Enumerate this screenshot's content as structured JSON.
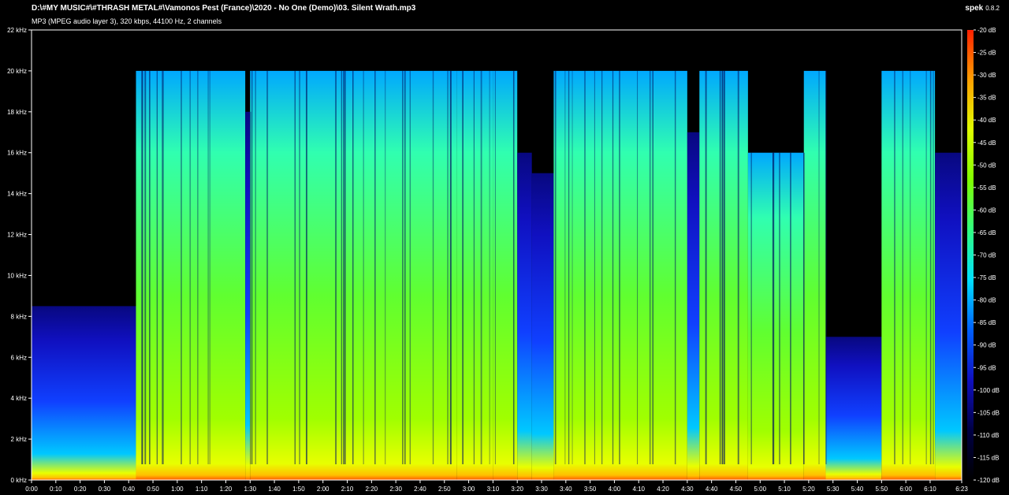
{
  "header": {
    "file_path": "D:\\#MY MUSIC#\\#THRASH METAL#\\Vamonos Pest (France)\\2020 - No One (Demo)\\03. Silent Wrath.mp3",
    "format_info": "MP3 (MPEG audio layer 3), 320 kbps, 44100 Hz, 2 channels",
    "app_name": "spek",
    "app_version": "0.8.2"
  },
  "chart_data": {
    "type": "heatmap",
    "title": "",
    "xlabel": "",
    "ylabel": "",
    "duration_seconds": 383,
    "ylim_khz": [
      0,
      22
    ],
    "x_ticks": [
      "0:00",
      "0:10",
      "0:20",
      "0:30",
      "0:40",
      "0:50",
      "1:00",
      "1:10",
      "1:20",
      "1:30",
      "1:40",
      "1:50",
      "2:00",
      "2:10",
      "2:20",
      "2:30",
      "2:40",
      "2:50",
      "3:00",
      "3:10",
      "3:20",
      "3:30",
      "3:40",
      "3:50",
      "4:00",
      "4:10",
      "4:20",
      "4:30",
      "4:40",
      "4:50",
      "5:00",
      "5:10",
      "5:20",
      "5:30",
      "5:40",
      "5:50",
      "6:00",
      "6:10",
      "6:23"
    ],
    "x_tick_seconds": [
      0,
      10,
      20,
      30,
      40,
      50,
      60,
      70,
      80,
      90,
      100,
      110,
      120,
      130,
      140,
      150,
      160,
      170,
      180,
      190,
      200,
      210,
      220,
      230,
      240,
      250,
      260,
      270,
      280,
      290,
      300,
      310,
      320,
      330,
      340,
      350,
      360,
      370,
      383
    ],
    "y_ticks": [
      "0 kHz",
      "2 kHz",
      "4 kHz",
      "6 kHz",
      "8 kHz",
      "10 kHz",
      "12 kHz",
      "14 kHz",
      "16 kHz",
      "18 kHz",
      "20 kHz",
      "22 kHz"
    ],
    "y_tick_khz": [
      0,
      2,
      4,
      6,
      8,
      10,
      12,
      14,
      16,
      18,
      20,
      22
    ],
    "db_range": [
      -120,
      -20
    ],
    "db_ticks": [
      "-20 dB",
      "-25 dB",
      "-30 dB",
      "-35 dB",
      "-40 dB",
      "-45 dB",
      "-50 dB",
      "-55 dB",
      "-60 dB",
      "-65 dB",
      "-70 dB",
      "-75 dB",
      "-80 dB",
      "-85 dB",
      "-90 dB",
      "-95 dB",
      "-100 dB",
      "-105 dB",
      "-110 dB",
      "-115 dB",
      "-120 dB"
    ],
    "db_tick_values": [
      -20,
      -25,
      -30,
      -35,
      -40,
      -45,
      -50,
      -55,
      -60,
      -65,
      -70,
      -75,
      -80,
      -85,
      -90,
      -95,
      -100,
      -105,
      -110,
      -115,
      -120
    ],
    "colormap": [
      "#000000",
      "#000044",
      "#1010c0",
      "#0060ff",
      "#00e0ff",
      "#30ff80",
      "#80ff00",
      "#e0ff00",
      "#ffa000",
      "#ff2000"
    ],
    "segments": [
      {
        "start": 0,
        "end": 43,
        "cutoff_khz": 8.5,
        "intensity": 0.35
      },
      {
        "start": 43,
        "end": 88,
        "cutoff_khz": 20,
        "intensity": 0.8
      },
      {
        "start": 88,
        "end": 90,
        "cutoff_khz": 18,
        "intensity": 0.6
      },
      {
        "start": 90,
        "end": 175,
        "cutoff_khz": 20,
        "intensity": 0.82
      },
      {
        "start": 175,
        "end": 190,
        "cutoff_khz": 20,
        "intensity": 0.7
      },
      {
        "start": 190,
        "end": 200,
        "cutoff_khz": 20,
        "intensity": 0.65
      },
      {
        "start": 200,
        "end": 206,
        "cutoff_khz": 16,
        "intensity": 0.4
      },
      {
        "start": 206,
        "end": 215,
        "cutoff_khz": 15,
        "intensity": 0.45
      },
      {
        "start": 215,
        "end": 270,
        "cutoff_khz": 20,
        "intensity": 0.82
      },
      {
        "start": 270,
        "end": 275,
        "cutoff_khz": 17,
        "intensity": 0.55
      },
      {
        "start": 275,
        "end": 295,
        "cutoff_khz": 20,
        "intensity": 0.8
      },
      {
        "start": 295,
        "end": 318,
        "cutoff_khz": 16,
        "intensity": 0.65
      },
      {
        "start": 318,
        "end": 327,
        "cutoff_khz": 20,
        "intensity": 0.75
      },
      {
        "start": 327,
        "end": 350,
        "cutoff_khz": 7,
        "intensity": 0.4
      },
      {
        "start": 350,
        "end": 372,
        "cutoff_khz": 20,
        "intensity": 0.78
      },
      {
        "start": 372,
        "end": 383,
        "cutoff_khz": 16,
        "intensity": 0.55
      }
    ]
  }
}
